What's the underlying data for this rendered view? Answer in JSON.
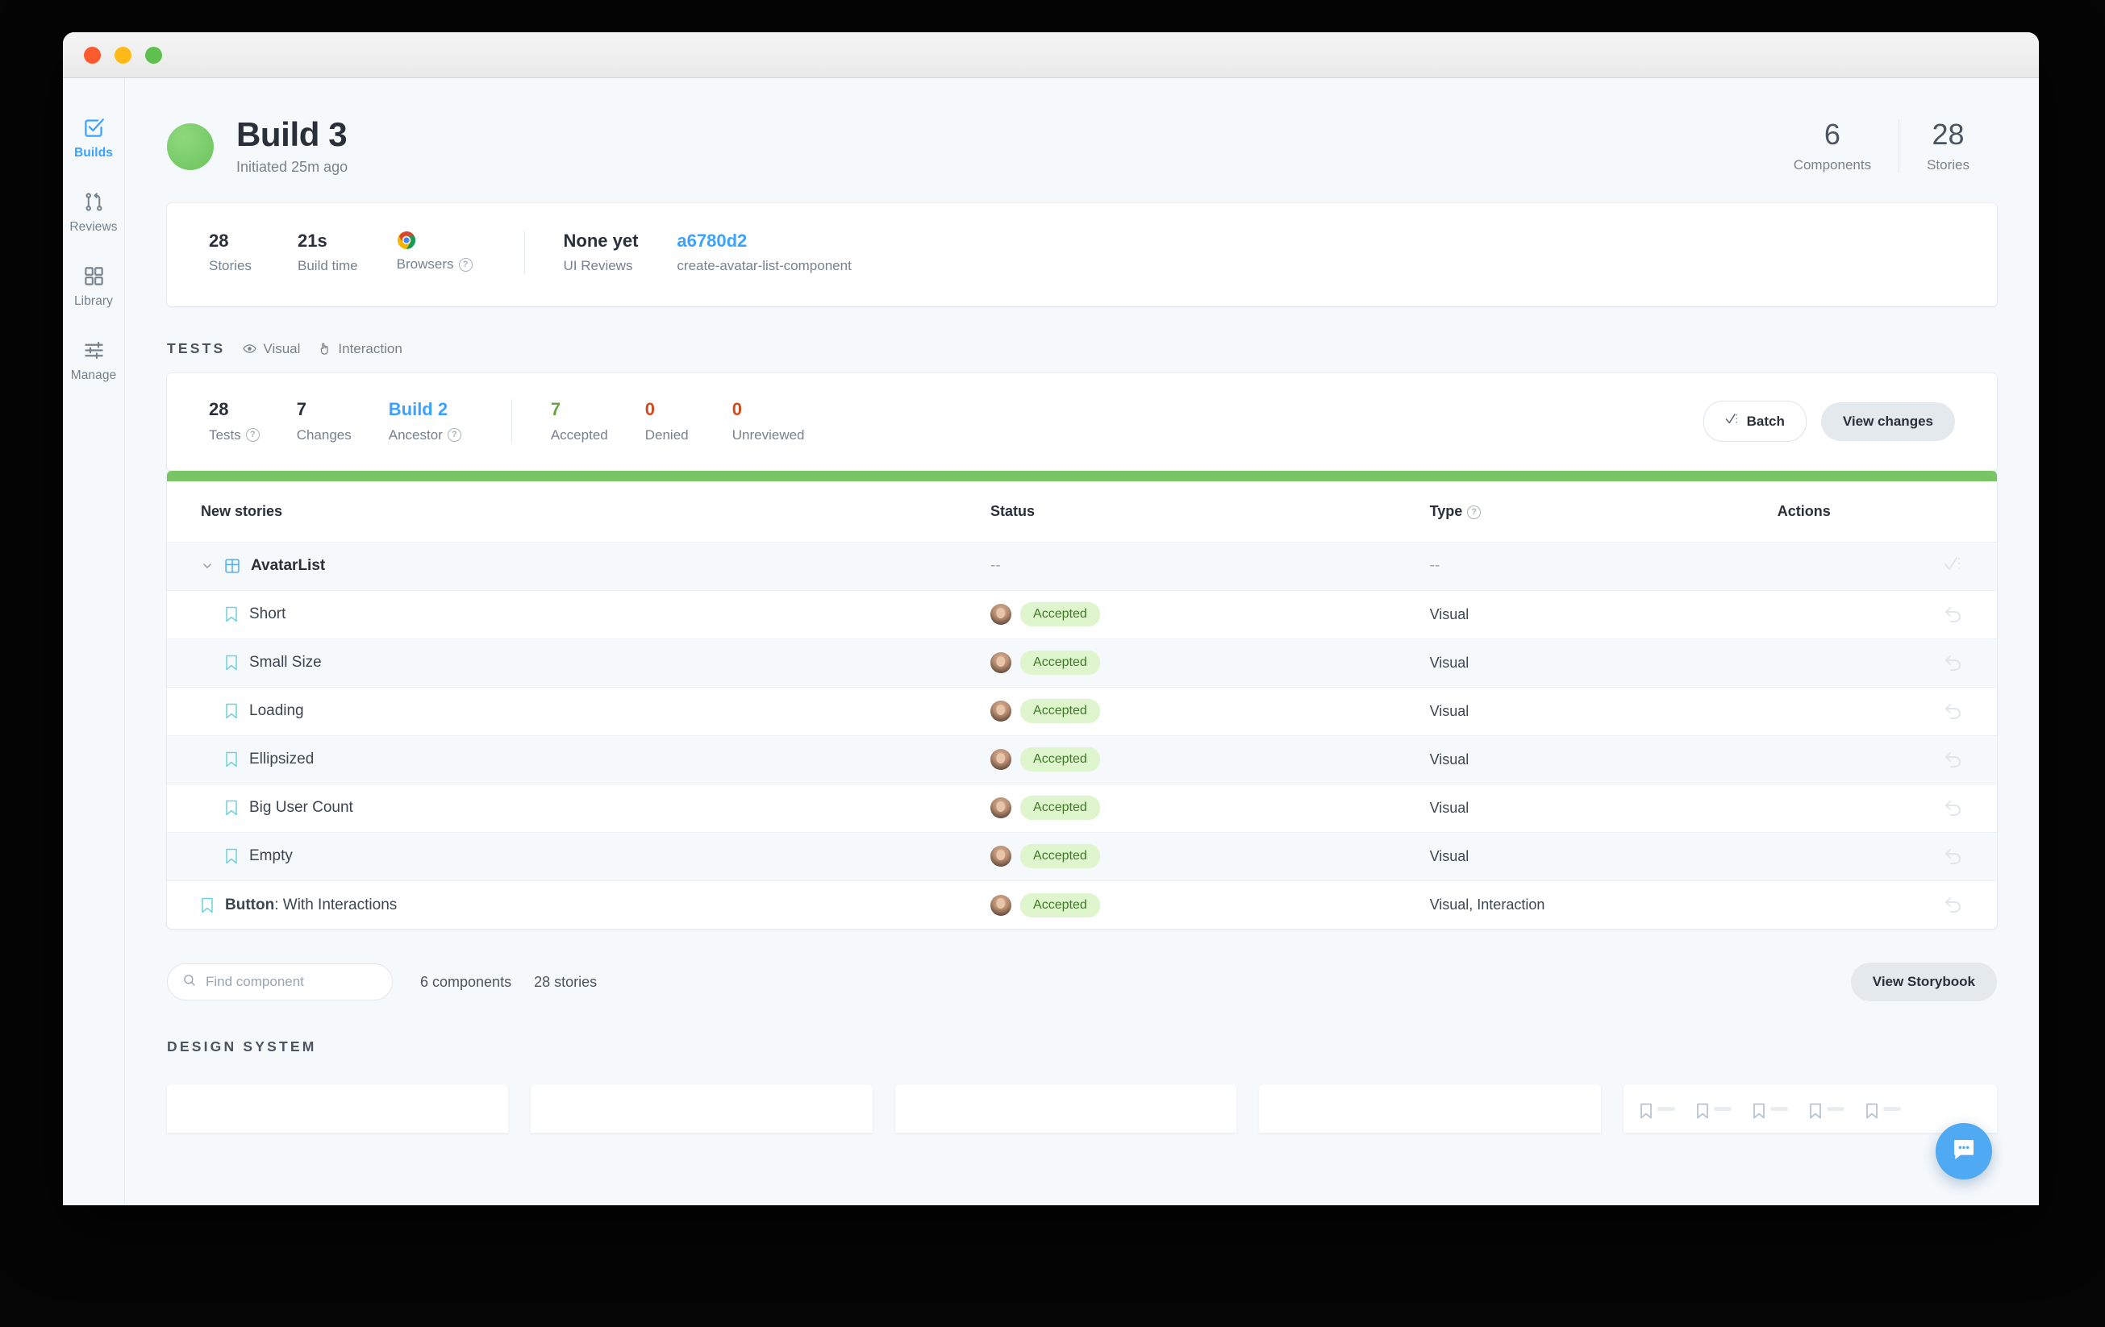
{
  "window": {
    "traffic_lights": [
      "close",
      "minimize",
      "maximize"
    ]
  },
  "sidebar": {
    "items": [
      {
        "label": "Builds",
        "icon": "check-square-icon",
        "active": true
      },
      {
        "label": "Reviews",
        "icon": "git-pull-request-icon",
        "active": false
      },
      {
        "label": "Library",
        "icon": "grid-squares-icon",
        "active": false
      },
      {
        "label": "Manage",
        "icon": "sliders-icon",
        "active": false
      }
    ]
  },
  "header": {
    "title": "Build 3",
    "subtitle": "Initiated 25m ago",
    "stats": [
      {
        "value": "6",
        "label": "Components"
      },
      {
        "value": "28",
        "label": "Stories"
      }
    ]
  },
  "summary": {
    "stats": [
      {
        "value": "28",
        "label": "Stories"
      },
      {
        "value": "21s",
        "label": "Build time"
      },
      {
        "value": "",
        "label": "Browsers",
        "icon": "chrome-icon",
        "help": true
      }
    ],
    "right_stats": [
      {
        "value": "None yet",
        "label": "UI Reviews"
      },
      {
        "value": "a6780d2",
        "label": "create-avatar-list-component",
        "link": true
      }
    ]
  },
  "tests": {
    "section_title": "TESTS",
    "chips": [
      {
        "label": "Visual",
        "icon": "eye-icon"
      },
      {
        "label": "Interaction",
        "icon": "pointer-icon"
      }
    ],
    "stats": [
      {
        "value": "28",
        "label": "Tests",
        "help": true
      },
      {
        "value": "7",
        "label": "Changes",
        "help": false
      },
      {
        "value": "Build 2",
        "label": "Ancestor",
        "help": true,
        "style": "ancestor"
      }
    ],
    "review_stats": [
      {
        "value": "7",
        "label": "Accepted",
        "style": "accepted"
      },
      {
        "value": "0",
        "label": "Denied",
        "style": "denied"
      },
      {
        "value": "0",
        "label": "Unreviewed",
        "style": "unreviewed"
      }
    ],
    "batch_label": "Batch",
    "view_changes_label": "View changes"
  },
  "table": {
    "stripe_color": "#79c565",
    "columns": [
      "New stories",
      "Status",
      "Type",
      "Actions"
    ],
    "type_help": true,
    "rows": [
      {
        "kind": "group",
        "name": "AvatarList",
        "status": "--",
        "type": "--",
        "action_icon": "batch-check-icon"
      },
      {
        "kind": "story",
        "name": "Short",
        "status": "Accepted",
        "type": "Visual",
        "action_icon": "undo-icon"
      },
      {
        "kind": "story",
        "name": "Small Size",
        "status": "Accepted",
        "type": "Visual",
        "action_icon": "undo-icon"
      },
      {
        "kind": "story",
        "name": "Loading",
        "status": "Accepted",
        "type": "Visual",
        "action_icon": "undo-icon"
      },
      {
        "kind": "story",
        "name": "Ellipsized",
        "status": "Accepted",
        "type": "Visual",
        "action_icon": "undo-icon"
      },
      {
        "kind": "story",
        "name": "Big User Count",
        "status": "Accepted",
        "type": "Visual",
        "action_icon": "undo-icon"
      },
      {
        "kind": "story",
        "name": "Empty",
        "status": "Accepted",
        "type": "Visual",
        "action_icon": "undo-icon"
      },
      {
        "kind": "story-root",
        "name_bold": "Button",
        "name": ": With Interactions",
        "status": "Accepted",
        "type": "Visual, Interaction",
        "action_icon": "undo-icon"
      }
    ]
  },
  "bottom": {
    "search_placeholder": "Find component",
    "search_value": "",
    "components_count": "6 components",
    "stories_count": "28 stories",
    "view_storybook_label": "View Storybook"
  },
  "design_system": {
    "title": "DESIGN SYSTEM"
  },
  "colors": {
    "accent_blue": "#3ba2ff",
    "status_green": "#79c565",
    "badge_bg": "#dff5cd",
    "badge_text": "#3c7a24",
    "denied_red": "#d14a1e",
    "page_bg": "#f6f9fc"
  }
}
